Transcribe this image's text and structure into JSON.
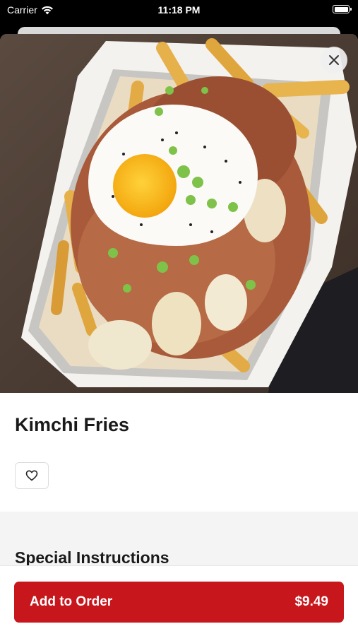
{
  "status_bar": {
    "carrier": "Carrier",
    "time": "11:18 PM"
  },
  "item": {
    "title": "Kimchi Fries",
    "image_icon": "kimchi-fries-photo"
  },
  "icons": {
    "close": "close-icon",
    "favorite": "heart-icon",
    "wifi": "wifi-icon",
    "battery": "battery-icon"
  },
  "special_instructions": {
    "title": "Special Instructions"
  },
  "footer": {
    "add_label": "Add to Order",
    "price": "$9.49"
  },
  "colors": {
    "accent": "#c8161d",
    "section_bg": "#f4f4f4"
  }
}
